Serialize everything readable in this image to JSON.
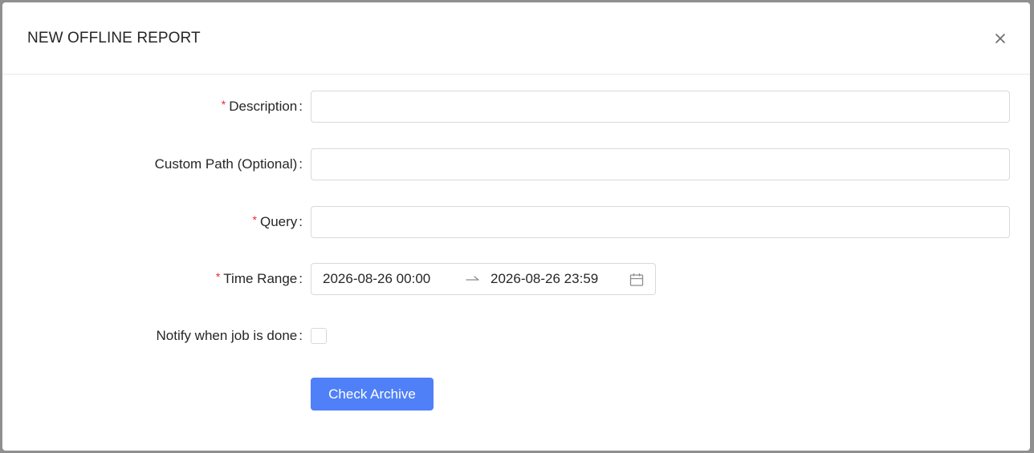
{
  "dialog": {
    "title": "NEW OFFLINE REPORT",
    "close_icon": "close-icon"
  },
  "form": {
    "description": {
      "label": "Description",
      "required": true,
      "value": "",
      "placeholder": ""
    },
    "custom_path": {
      "label": "Custom Path (Optional)",
      "required": false,
      "value": "",
      "placeholder": ""
    },
    "query": {
      "label": "Query",
      "required": true,
      "value": "",
      "placeholder": ""
    },
    "time_range": {
      "label": "Time Range",
      "required": true,
      "start": "2026-08-26 00:00",
      "end": "2026-08-26 23:59",
      "separator_icon": "arrow-right-icon",
      "calendar_icon": "calendar-icon"
    },
    "notify": {
      "label": "Notify when job is done",
      "checked": false
    },
    "required_mark": "*",
    "colon": ":"
  },
  "actions": {
    "check_archive_label": "Check Archive"
  },
  "colors": {
    "primary": "#4f80f7",
    "required": "#f5222d",
    "border": "#d9d9d9",
    "backdrop": "#8f8f8f"
  }
}
